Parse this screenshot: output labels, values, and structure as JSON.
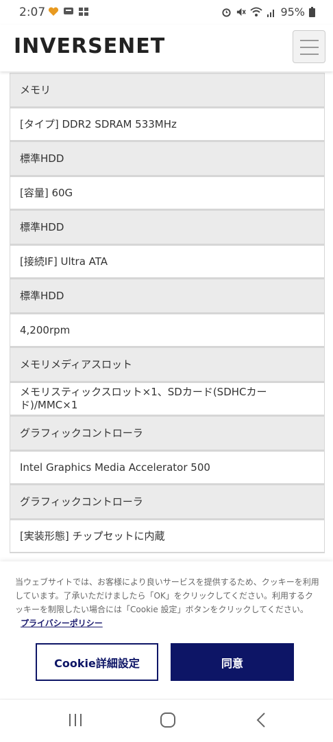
{
  "status": {
    "time": "2:07",
    "battery": "95%"
  },
  "header": {
    "logo": "INVERSENET"
  },
  "spec_rows": [
    {
      "kind": "h",
      "text": "メモリ"
    },
    {
      "kind": "v",
      "text": "[タイプ] DDR2 SDRAM 533MHz"
    },
    {
      "kind": "h",
      "text": "標準HDD"
    },
    {
      "kind": "v",
      "text": "[容量] 60G"
    },
    {
      "kind": "h",
      "text": "標準HDD"
    },
    {
      "kind": "v",
      "text": "[接続IF] Ultra ATA"
    },
    {
      "kind": "h",
      "text": "標準HDD"
    },
    {
      "kind": "v",
      "text": "4,200rpm"
    },
    {
      "kind": "h",
      "text": "メモリメディアスロット"
    },
    {
      "kind": "v",
      "text": "メモリスティックスロット×1、SDカード(SDHCカード)/MMC×1"
    },
    {
      "kind": "h",
      "text": "グラフィックコントローラ"
    },
    {
      "kind": "v",
      "text": "Intel Graphics Media Accelerator 500"
    },
    {
      "kind": "h",
      "text": "グラフィックコントローラ"
    },
    {
      "kind": "v",
      "text": "[実装形態] チップセットに内蔵"
    }
  ],
  "cookie": {
    "message": "当ウェブサイトでは、お客様により良いサービスを提供するため、クッキーを利用しています。了承いただけましたら「OK」をクリックしてください。利用するクッキーを制限したい場合には「Cookie 設定」ボタンをクリックしてください。",
    "privacy_link": "プライバシーポリシー",
    "settings_button": "Cookie詳細設定",
    "agree_button": "同意"
  },
  "colors": {
    "accent": "#0d1566",
    "header_row_bg": "#ebebeb"
  },
  "icons": [
    "alarm-icon",
    "mute-icon",
    "wifi-icon",
    "signal-icon",
    "battery-icon",
    "hamburger-menu-icon",
    "recent-apps-icon",
    "home-icon",
    "back-icon"
  ]
}
